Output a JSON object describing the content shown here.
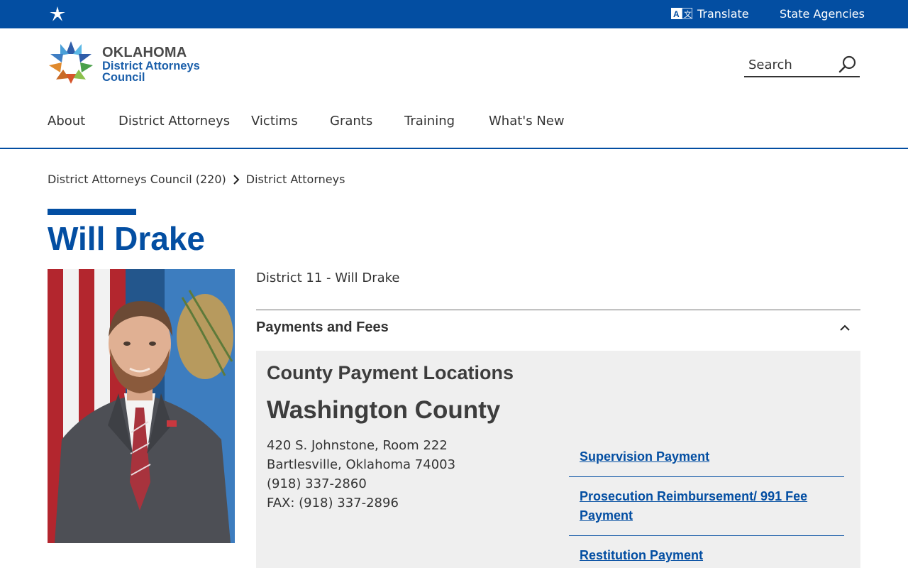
{
  "topbar": {
    "translate_label": "Translate",
    "agencies_label": "State Agencies",
    "icons": [
      "oklahoma-star-icon",
      "translate-icon"
    ]
  },
  "header": {
    "logo": {
      "line1": "OKLAHOMA",
      "line2": "District Attorneys",
      "line3": "Council"
    },
    "search": {
      "placeholder": "Search",
      "icon": "search-icon"
    }
  },
  "nav": {
    "items": [
      {
        "label": "About"
      },
      {
        "label": "District Attorneys"
      },
      {
        "label": "Victims"
      },
      {
        "label": "Grants"
      },
      {
        "label": "Training"
      },
      {
        "label": "What's New"
      }
    ]
  },
  "breadcrumb": {
    "items": [
      {
        "label": "District Attorneys Council (220)"
      },
      {
        "label": "District Attorneys"
      }
    ]
  },
  "page": {
    "title": "Will Drake",
    "district": "District 11 - Will Drake"
  },
  "accordion": {
    "title": "Payments and Fees",
    "expanded": true,
    "subheading": "County Payment Locations",
    "county": "Washington County",
    "address": {
      "street": "420 S. Johnstone, Room 222",
      "city": "Bartlesville, Oklahoma 74003",
      "phone": "(918) 337-2860",
      "fax": "FAX: (918) 337-2896"
    },
    "links": [
      {
        "label": "Supervision Payment"
      },
      {
        "label": "Prosecution Reimbursement/ 991 Fee Payment"
      },
      {
        "label": "Restitution Payment"
      }
    ]
  },
  "colors": {
    "brand_blue": "#034ea2",
    "panel_gray": "#efefef",
    "text": "#333333"
  }
}
